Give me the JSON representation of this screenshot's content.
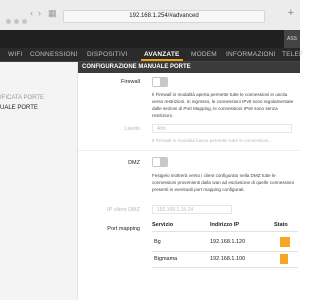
{
  "browser": {
    "url": "192.168.1.254/#advanced"
  },
  "header": {
    "assist_label": "ASS"
  },
  "nav": {
    "items": [
      "WIFI",
      "CONNESSIONI",
      "DISPOSITIVI",
      "AVANZATE",
      "MODEM",
      "INFORMAZIONI",
      "TELEF"
    ],
    "active": "AVANZATE"
  },
  "sidebar": {
    "items": [
      "IFICATA PORTE",
      "UALE PORTE"
    ]
  },
  "section": {
    "title": "CONFIGURAZIONE MANUALE PORTE"
  },
  "firewall": {
    "label": "Firewall",
    "description": "Il Firewall in modalità aperta permette tutte le connessioni in uscita verso restrizioni. In ingresso, le connessioni IPv6 sono regolamentate dalle sezioni di Port Mapping, le connessioni IPv6 sono senza restrizioni."
  },
  "livello": {
    "label": "Livello",
    "value": "Alto",
    "description": "Il Firewall in modalità bassa permette tutte le connessioni..."
  },
  "dmz": {
    "label": "DMZ",
    "description": "Festgelo inoltrerà verso i client configurato nella DMZ tutte le connessioni provenienti dalla wan ad esclusione di quelle connessioni presenti in eventuali port mapping configurati."
  },
  "ip_dmz": {
    "label": "IP client DMZ",
    "placeholder": "192.168.1.15.14"
  },
  "port_mapping": {
    "label": "Port mapping",
    "headers": {
      "service": "Servizio",
      "ip": "Indirizzo IP",
      "state": "Stato"
    },
    "rows": [
      {
        "service": "Bg",
        "ip": "192.168.1.120",
        "state_color": "#f5a623"
      },
      {
        "service": "Bigmama",
        "ip": "192.168.1.100",
        "state_color": "#f5a623"
      }
    ]
  }
}
